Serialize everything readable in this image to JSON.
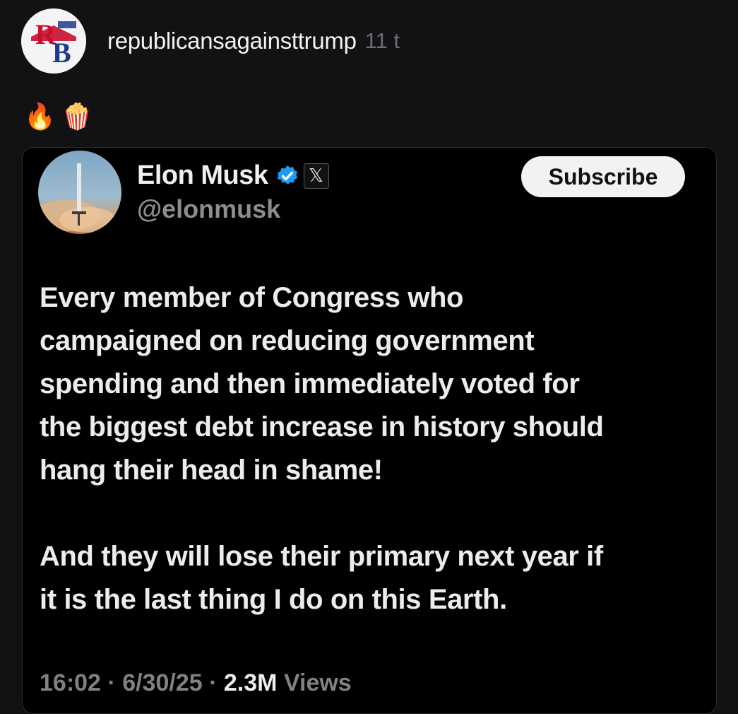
{
  "post": {
    "username": "republicansagainsttrump",
    "time": "11 t",
    "avatar_letters": "RB",
    "emojis": [
      "🔥",
      "🍿"
    ]
  },
  "tweet": {
    "name": "Elon Musk",
    "handle": "@elonmusk",
    "x_badge": "𝕏",
    "subscribe_label": "Subscribe",
    "text": "Every member of Congress who\ncampaigned on reducing government\nspending and then immediately voted for\nthe biggest debt increase in history should\nhang their head in shame!\n\nAnd they will lose their primary next year if\nit is the last thing I do on this Earth.",
    "time": "16:02",
    "date": "6/30/25",
    "views_count": "2.3M",
    "views_label": "Views",
    "separator": "·"
  },
  "colors": {
    "background": "#121214",
    "verified": "#1d9bf0",
    "logo_red": "#c8102e",
    "logo_blue": "#1f3a8a"
  },
  "icons": {
    "verified": "verified-badge-icon",
    "x_logo": "x-logo-icon"
  }
}
